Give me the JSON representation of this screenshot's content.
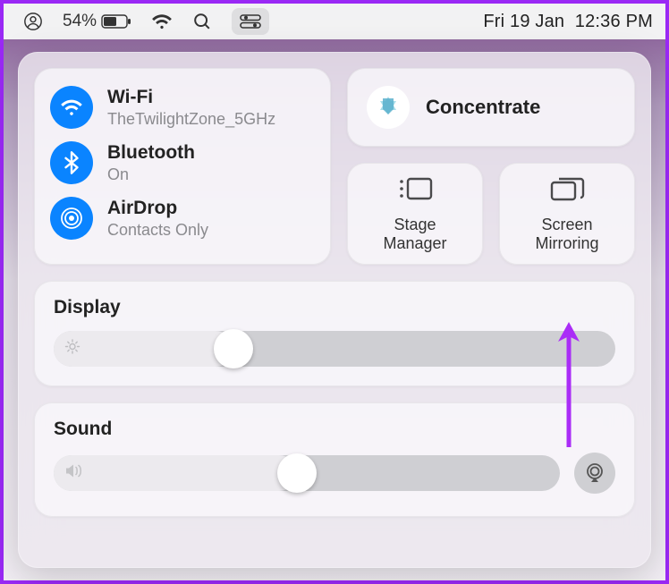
{
  "menubar": {
    "battery_percent": "54%",
    "date": "Fri 19 Jan",
    "time": "12:36 PM"
  },
  "connectivity": {
    "wifi": {
      "title": "Wi-Fi",
      "subtitle": "TheTwilightZone_5GHz"
    },
    "bluetooth": {
      "title": "Bluetooth",
      "subtitle": "On"
    },
    "airdrop": {
      "title": "AirDrop",
      "subtitle": "Contacts Only"
    }
  },
  "focus": {
    "label": "Concentrate"
  },
  "mini": {
    "stage": {
      "line1": "Stage",
      "line2": "Manager"
    },
    "mirror": {
      "line1": "Screen",
      "line2": "Mirroring"
    }
  },
  "sliders": {
    "display": {
      "title": "Display",
      "value_pct": 32
    },
    "sound": {
      "title": "Sound",
      "value_pct": 48
    }
  },
  "colors": {
    "accent_blue": "#0a84ff",
    "arrow": "#aa2cf7"
  }
}
